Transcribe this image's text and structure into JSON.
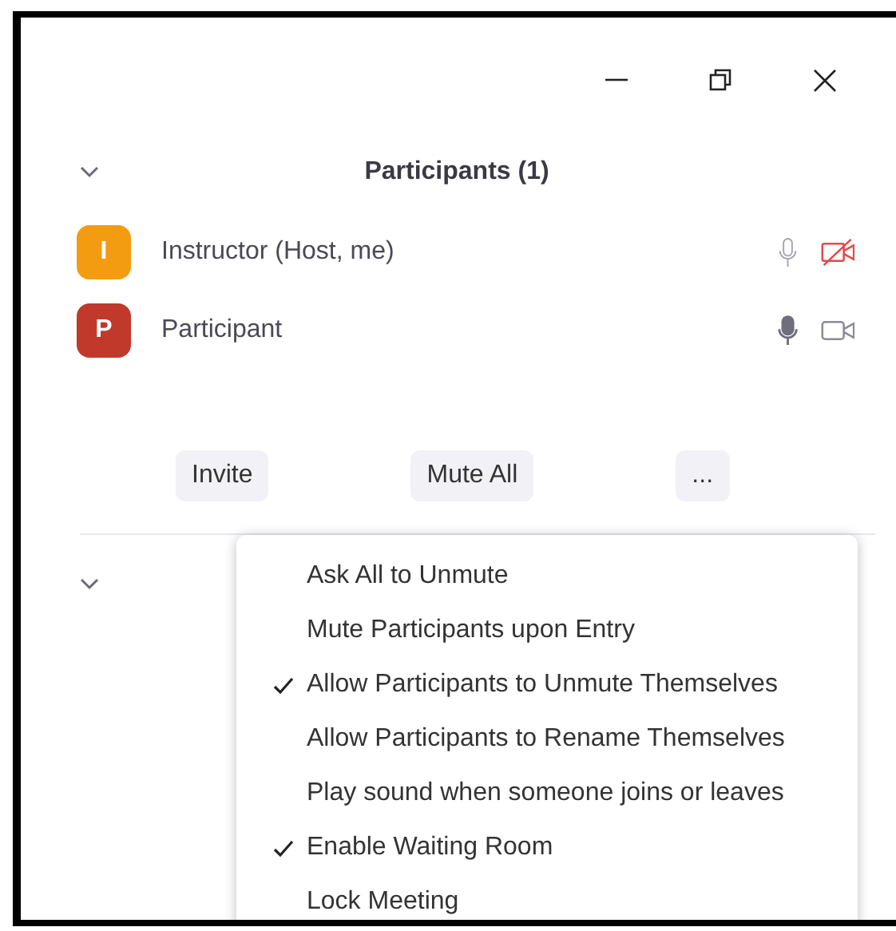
{
  "window": {
    "controls": [
      {
        "kind": "minimize"
      },
      {
        "kind": "restore"
      },
      {
        "kind": "close"
      }
    ]
  },
  "panel": {
    "title": "Participants (1)"
  },
  "participants": [
    {
      "initial": "I",
      "name": "Instructor (Host, me)",
      "color": "#f39c12",
      "audio_active": false,
      "video_on": false
    },
    {
      "initial": "P",
      "name": "Participant",
      "color": "#c0392b",
      "audio_active": true,
      "video_on": true
    }
  ],
  "buttons": [
    "Invite",
    "Mute All",
    "..."
  ],
  "menu": [
    {
      "label": "Ask All to Unmute",
      "checked": false
    },
    {
      "label": "Mute Participants upon Entry",
      "checked": false
    },
    {
      "label": "Allow Participants to Unmute Themselves",
      "checked": true
    },
    {
      "label": "Allow Participants to Rename Themselves",
      "checked": false
    },
    {
      "label": "Play sound when someone joins or leaves",
      "checked": false
    },
    {
      "label": "Enable Waiting Room",
      "checked": true
    },
    {
      "label": "Lock Meeting",
      "checked": false
    }
  ]
}
